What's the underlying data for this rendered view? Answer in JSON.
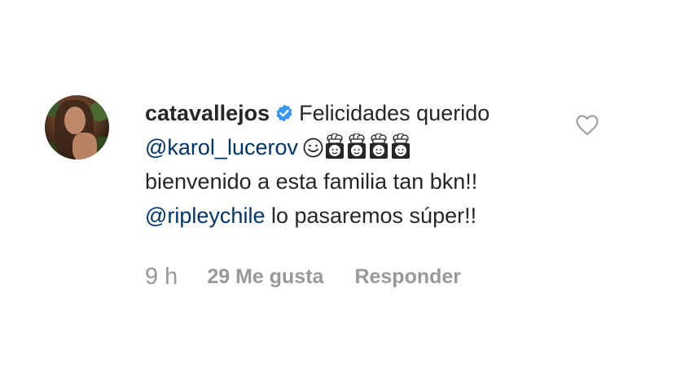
{
  "comment": {
    "username": "catavallejos",
    "verified_icon": "verified-badge-icon",
    "text_line1": "Felicidades querido",
    "mention1": "@karol_lucerov",
    "line3": "bienvenido a esta familia tan bkn!!",
    "mention2": "@ripleychile",
    "line4_rest": " lo pasaremos súper!!",
    "emojis": [
      "smile-emoji",
      "chef-emoji",
      "chef-emoji",
      "chef-emoji",
      "chef-emoji"
    ]
  },
  "meta": {
    "time": "9 h",
    "likes": "29 Me gusta",
    "reply": "Responder"
  },
  "icons": {
    "like": "heart-outline-icon"
  },
  "colors": {
    "text": "#262626",
    "mention": "#003569",
    "meta": "#999999",
    "verified": "#3897f0"
  }
}
